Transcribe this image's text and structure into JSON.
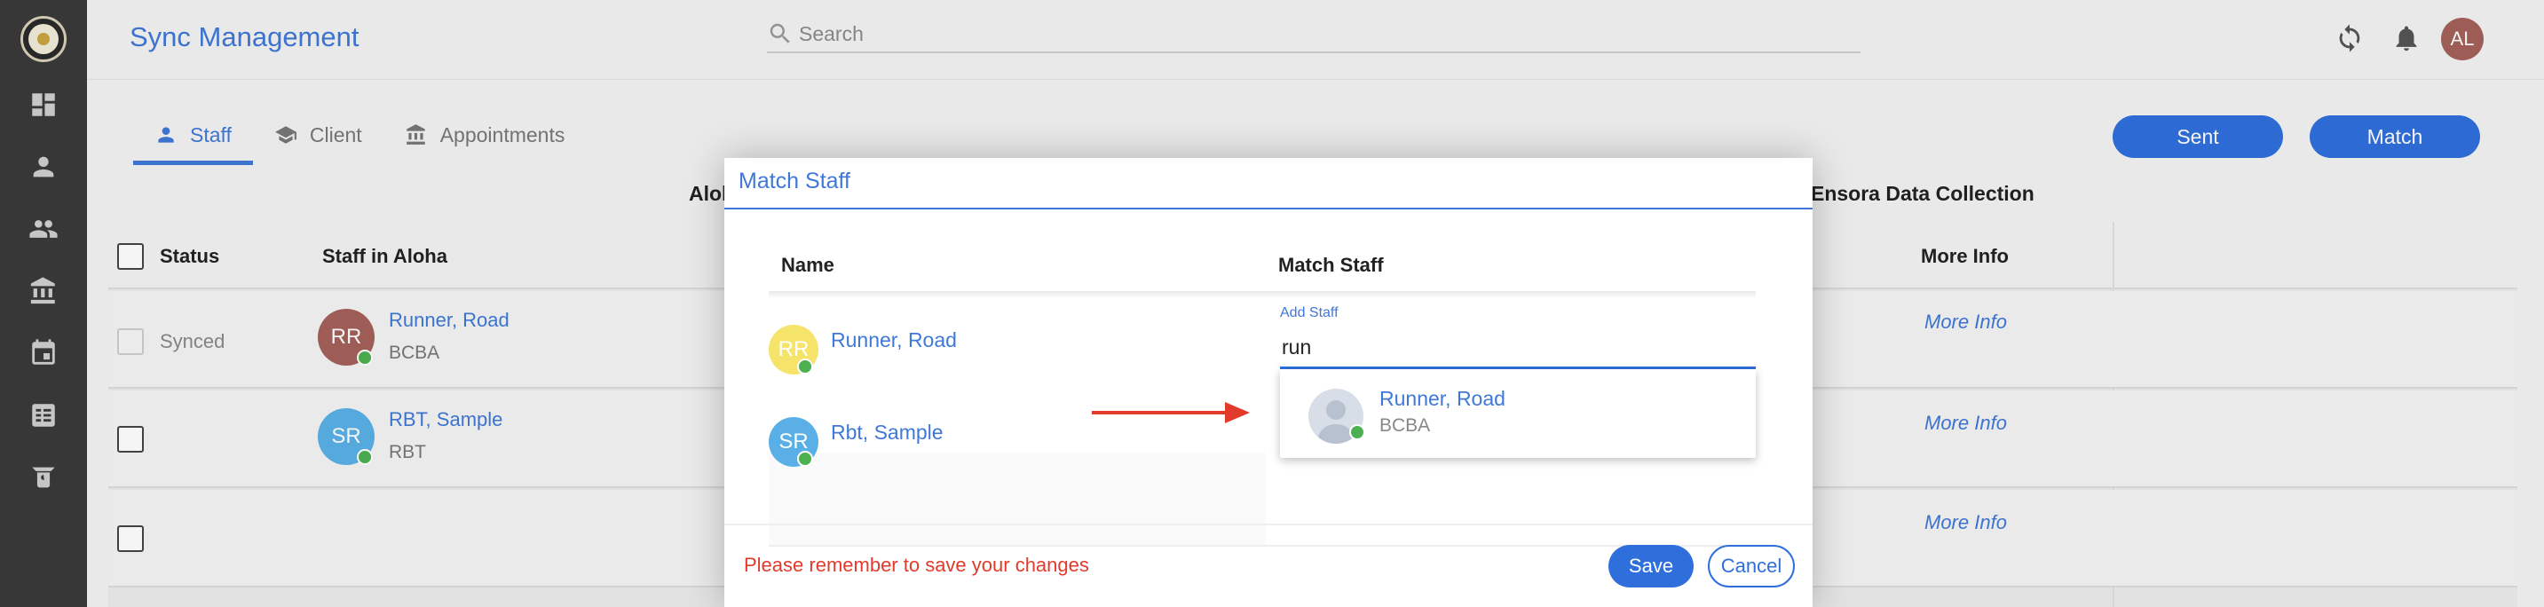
{
  "header": {
    "title": "Sync Management",
    "search_placeholder": "Search",
    "avatar_initials": "AL"
  },
  "tabs": [
    {
      "label": "Staff",
      "active": true
    },
    {
      "label": "Client",
      "active": false
    },
    {
      "label": "Appointments",
      "active": false
    }
  ],
  "actions": {
    "sent_label": "Sent",
    "match_label": "Match"
  },
  "table": {
    "group_left": "Aloh",
    "group_right": "Ensora Data Collection",
    "col_status": "Status",
    "col_staff": "Staff in Aloha",
    "col_more": "More Info",
    "rows": [
      {
        "status": "Synced",
        "initials": "RR",
        "name": "Runner, Road",
        "role": "BCBA",
        "more": "More Info",
        "color": "#a5605a"
      },
      {
        "status": "",
        "initials": "SR",
        "name": "RBT, Sample",
        "role": "RBT",
        "more": "More Info",
        "color": "#5ab0e6"
      },
      {
        "status": "",
        "initials": "",
        "name": "",
        "role": "",
        "more": "More Info"
      }
    ]
  },
  "modal": {
    "title": "Match Staff",
    "col_name": "Name",
    "col_match": "Match Staff",
    "rows": [
      {
        "initials": "RR",
        "name": "Runner, Road",
        "color": "#f5e36a"
      },
      {
        "initials": "SR",
        "name": "Rbt, Sample",
        "color": "#5ab0e6"
      }
    ],
    "add_staff_label": "Add Staff",
    "add_staff_value": "run",
    "suggestion": {
      "name": "Runner, Road",
      "role": "BCBA"
    },
    "reminder": "Please remember to save your changes",
    "save_label": "Save",
    "cancel_label": "Cancel"
  },
  "colors": {
    "accent": "#2f6fdc",
    "online": "#4caf50",
    "warning": "#e23a2b"
  }
}
